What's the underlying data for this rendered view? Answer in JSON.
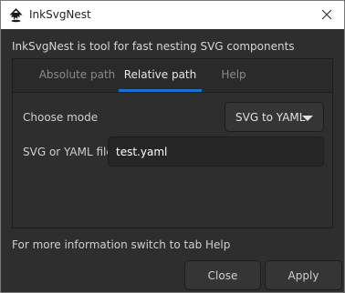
{
  "window": {
    "title": "InkSvgNest",
    "app_icon": "inkscape-logo-icon",
    "close_icon": "close-icon"
  },
  "description": "InkSvgNest is tool for fast nesting SVG components",
  "tabs": [
    {
      "label": "Absolute path",
      "active": false
    },
    {
      "label": "Relative path",
      "active": true
    },
    {
      "label": "Help",
      "active": false
    }
  ],
  "form": {
    "mode_label": "Choose mode",
    "mode_value": "SVG to YAML",
    "file_label": "SVG or YAML file",
    "file_value": "test.yaml"
  },
  "info_text": "For more information switch to tab Help",
  "buttons": {
    "close": "Close",
    "apply": "Apply"
  },
  "colors": {
    "background": "#2e2e2e",
    "tab_indicator": "#1f6fd3"
  }
}
